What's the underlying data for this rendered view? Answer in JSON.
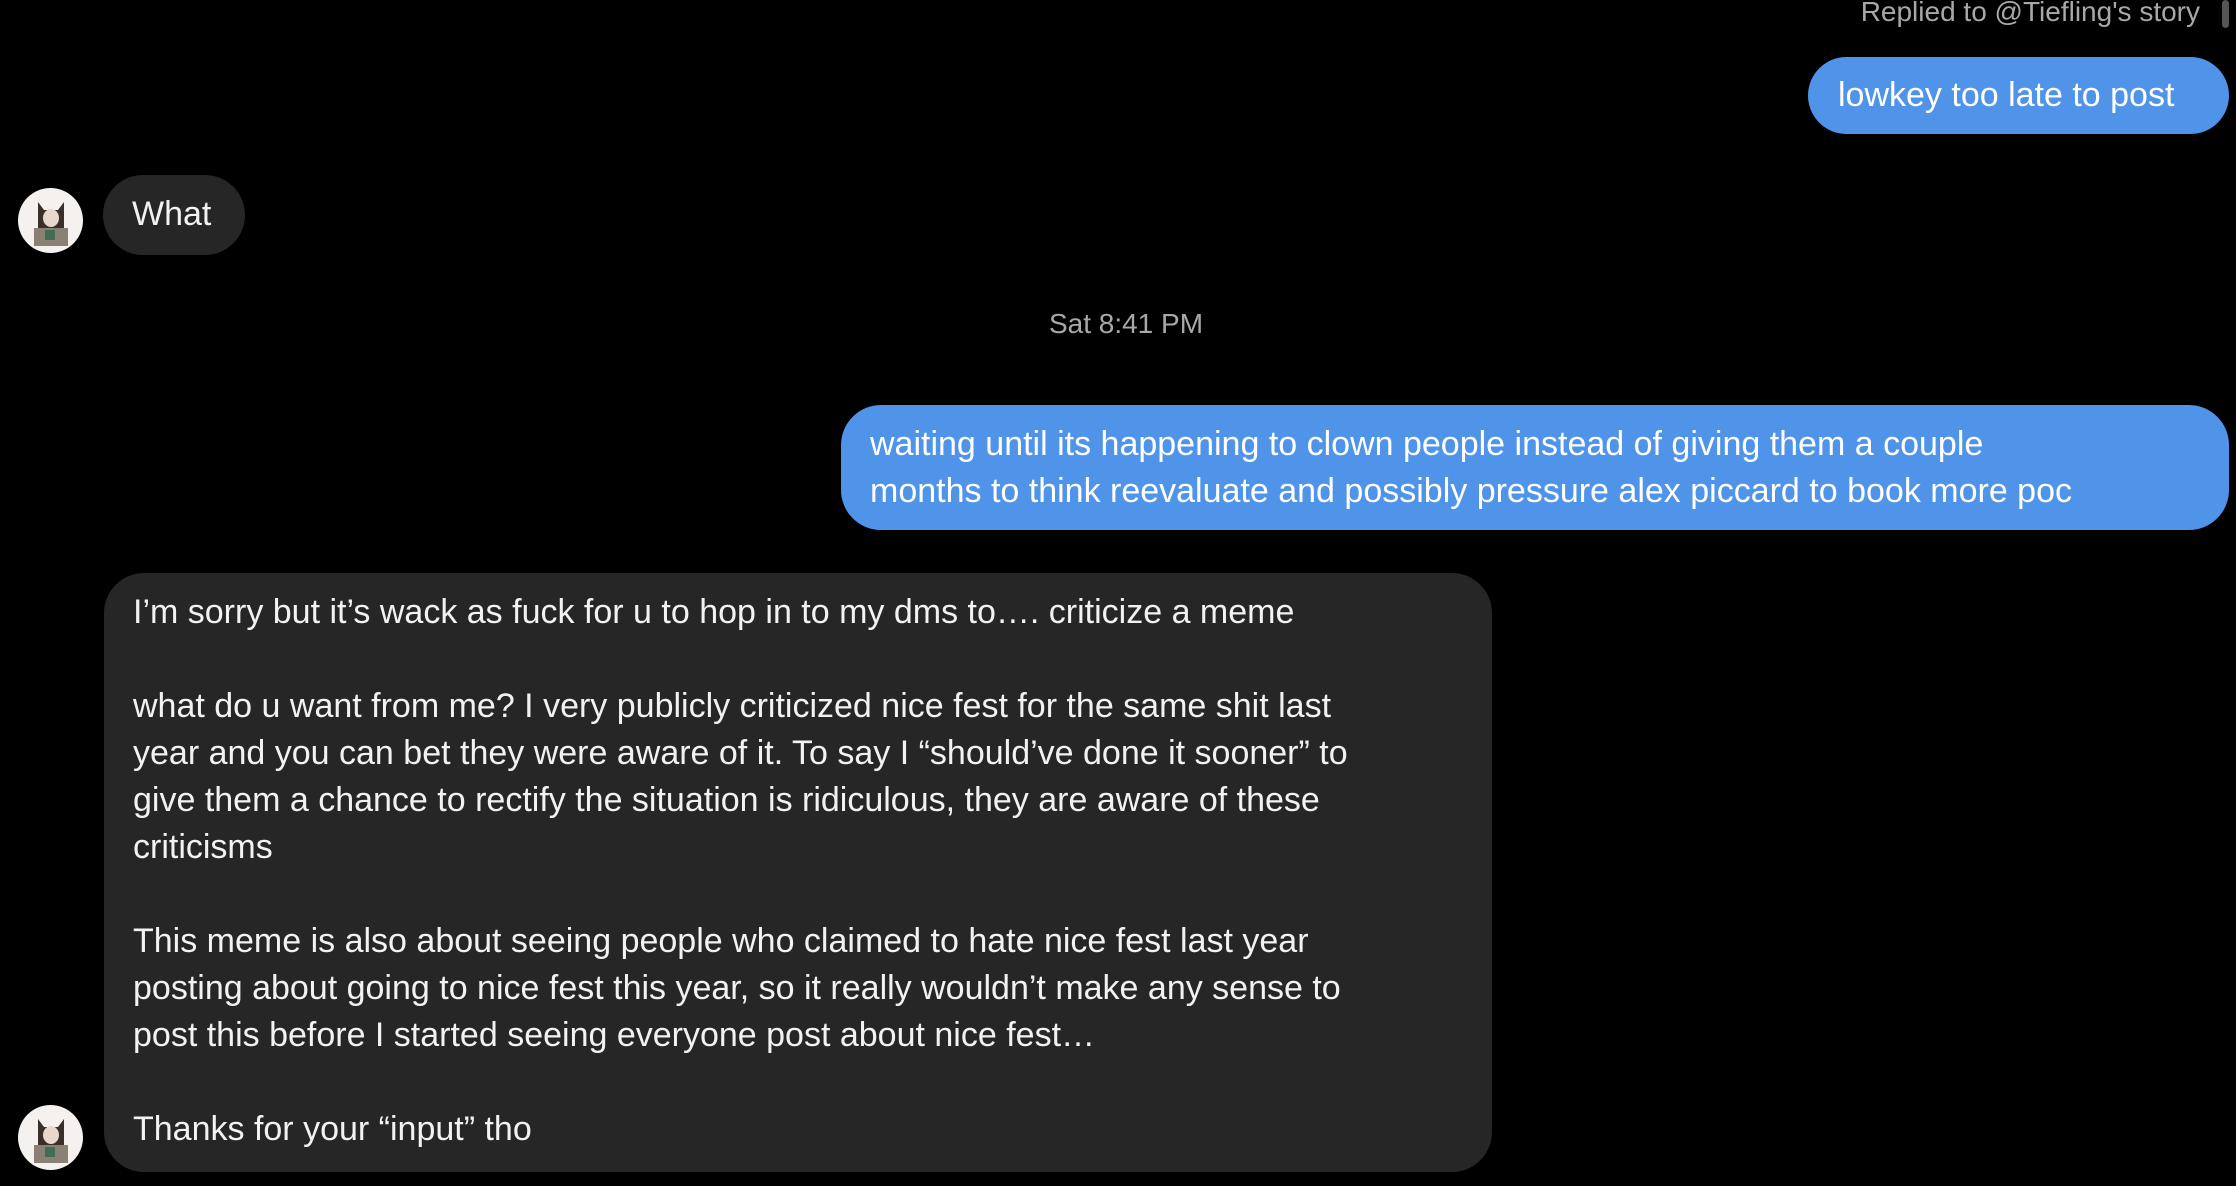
{
  "thread": {
    "reply_context": "Replied to @Tiefling's story",
    "timestamp": "Sat 8:41 PM",
    "messages": [
      {
        "sender": "me",
        "lines": [
          "lowkey too late to post"
        ]
      },
      {
        "sender": "them",
        "lines": [
          "What"
        ]
      },
      {
        "sender": "me",
        "lines": [
          "waiting until its happening to clown people instead of giving them a couple",
          "months to think reevaluate and possibly pressure alex piccard to book more poc"
        ]
      },
      {
        "sender": "them",
        "paragraphs": [
          [
            "I’m sorry but it’s wack as fuck for u to hop in to my dms to…. criticize a meme"
          ],
          [
            "what do u want from me? I very publicly criticized nice fest for the same shit last",
            "year and you can bet they were aware of it. To say I “should’ve done it sooner” to",
            "give them a chance to rectify the situation is ridiculous, they are aware of these",
            "criticisms"
          ],
          [
            "This meme is also about seeing people who claimed to hate nice fest last year",
            "posting about going to nice fest this year, so it really wouldn’t make any sense to",
            "post this before I started seeing everyone post about nice fest…"
          ],
          [
            "Thanks for your “input” tho"
          ]
        ]
      }
    ]
  },
  "colors": {
    "outgoing_bubble": "#4f94e8",
    "incoming_bubble": "#262626",
    "background": "#000000",
    "meta_text": "#a8a8a8"
  },
  "icons": {
    "avatar": "contact-avatar-illustration"
  }
}
